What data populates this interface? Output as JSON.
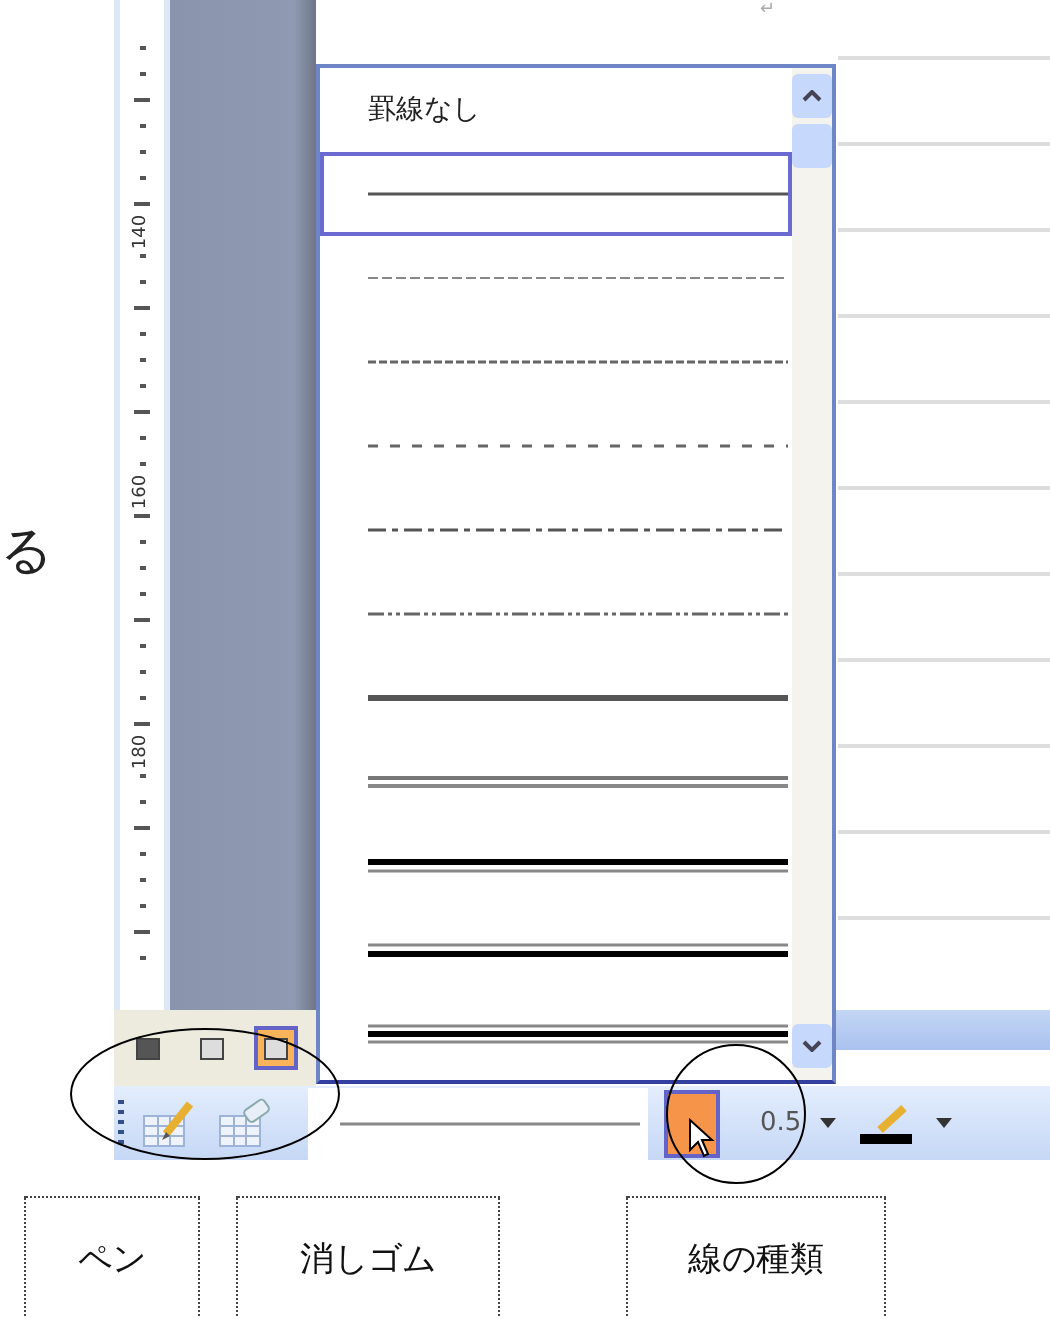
{
  "document": {
    "paragraph_mark": "↵",
    "margin_text": "る",
    "ruler_labels": [
      "140",
      "160",
      "180"
    ]
  },
  "view_buttons": [
    {
      "selected": false
    },
    {
      "selected": false
    },
    {
      "selected": true
    }
  ],
  "line_style_menu": {
    "items": [
      {
        "kind": "text",
        "label": "罫線なし",
        "selected": false
      },
      {
        "kind": "solid",
        "selected": true
      },
      {
        "kind": "dash-fine",
        "selected": false
      },
      {
        "kind": "dash-dense",
        "selected": false
      },
      {
        "kind": "dash",
        "selected": false
      },
      {
        "kind": "dash-dot",
        "selected": false
      },
      {
        "kind": "dash-dot-dot",
        "selected": false
      },
      {
        "kind": "thick",
        "selected": false
      },
      {
        "kind": "double",
        "selected": false
      },
      {
        "kind": "thick-thin",
        "selected": false
      },
      {
        "kind": "thin-thick",
        "selected": false
      },
      {
        "kind": "triple",
        "selected": false
      }
    ]
  },
  "toolbar": {
    "line_weight": "0.5"
  },
  "annotation_labels": [
    "ペン",
    "消しゴム",
    "線の種類"
  ]
}
